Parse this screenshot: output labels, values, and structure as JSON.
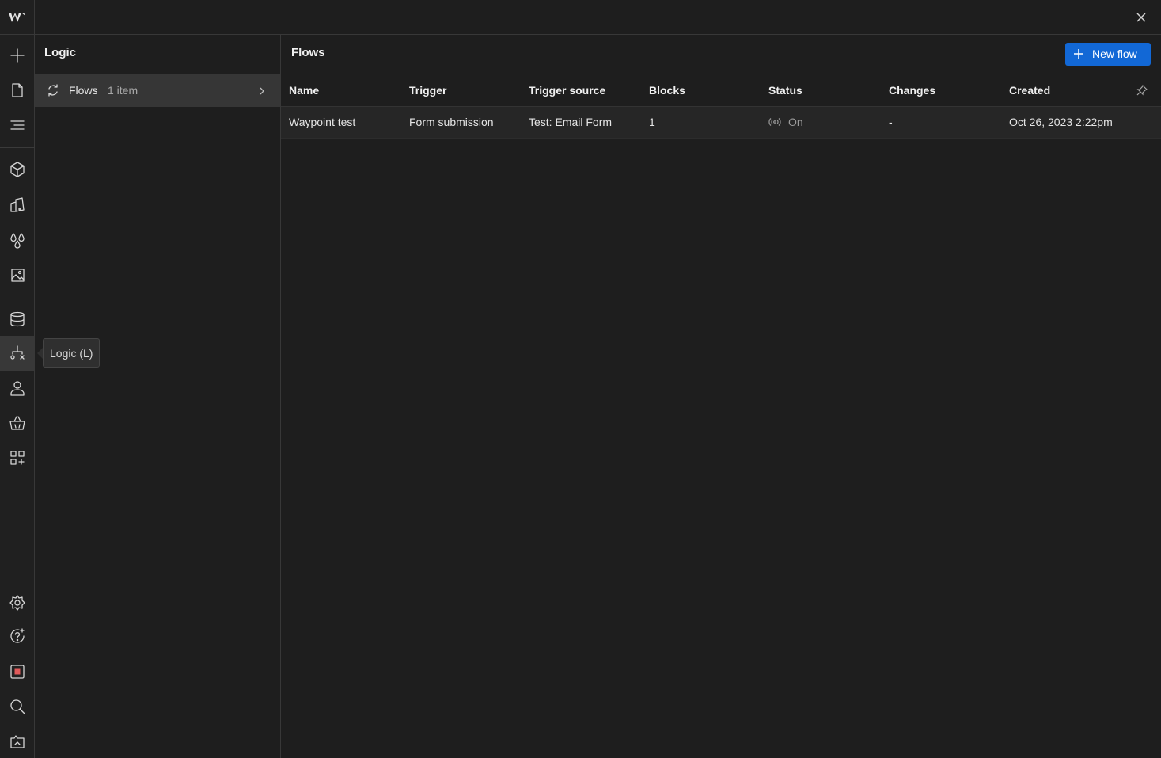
{
  "app": {
    "logo_text": "W"
  },
  "rail": {
    "items": [
      {
        "name": "add-icon"
      },
      {
        "name": "pages-icon"
      },
      {
        "name": "navigator-icon"
      },
      {
        "name": "components-icon"
      },
      {
        "name": "styles-icon"
      },
      {
        "name": "variables-icon"
      },
      {
        "name": "assets-icon"
      },
      {
        "name": "cms-icon"
      },
      {
        "name": "logic-icon"
      },
      {
        "name": "users-icon"
      },
      {
        "name": "ecommerce-icon"
      },
      {
        "name": "apps-icon"
      },
      {
        "name": "settings-icon"
      },
      {
        "name": "help-icon"
      },
      {
        "name": "record-icon"
      },
      {
        "name": "search-icon"
      },
      {
        "name": "video-icon"
      }
    ],
    "tooltip": "Logic (L)"
  },
  "panel": {
    "title": "Logic",
    "item": {
      "label": "Flows",
      "count": "1 item"
    }
  },
  "main": {
    "title": "Flows",
    "new_flow_label": "New flow",
    "columns": [
      "Name",
      "Trigger",
      "Trigger source",
      "Blocks",
      "Status",
      "Changes",
      "Created"
    ],
    "rows": [
      {
        "name": "Waypoint test",
        "trigger": "Form submission",
        "trigger_source": "Test: Email Form",
        "blocks": "1",
        "status": "On",
        "changes": "-",
        "created": "Oct 26, 2023 2:22pm"
      }
    ]
  },
  "colors": {
    "accent": "#1268d6",
    "background": "#1e1e1e",
    "selected": "#363636"
  }
}
